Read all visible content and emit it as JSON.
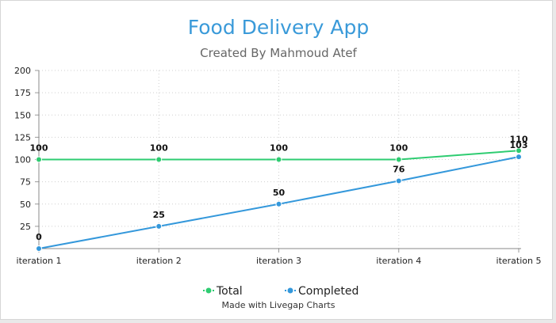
{
  "chart_data": {
    "type": "line",
    "title": "Food Delivery App",
    "subtitle": "Created By Mahmoud Atef",
    "categories": [
      "iteration 1",
      "iteration 2",
      "iteration 3",
      "iteration 4",
      "iteration 5"
    ],
    "series": [
      {
        "name": "Total",
        "color": "#2ecc71",
        "values": [
          100,
          100,
          100,
          100,
          110
        ]
      },
      {
        "name": "Completed",
        "color": "#3498db",
        "values": [
          0,
          25,
          50,
          76,
          103
        ]
      }
    ],
    "ylim": [
      0,
      200
    ],
    "yticks": [
      25,
      50,
      75,
      100,
      125,
      150,
      175,
      200
    ],
    "grid": true,
    "legend": "bottom",
    "footer": "Made with Livegap Charts",
    "title_color": "#3a9ad9",
    "subtitle_color": "#666666"
  }
}
